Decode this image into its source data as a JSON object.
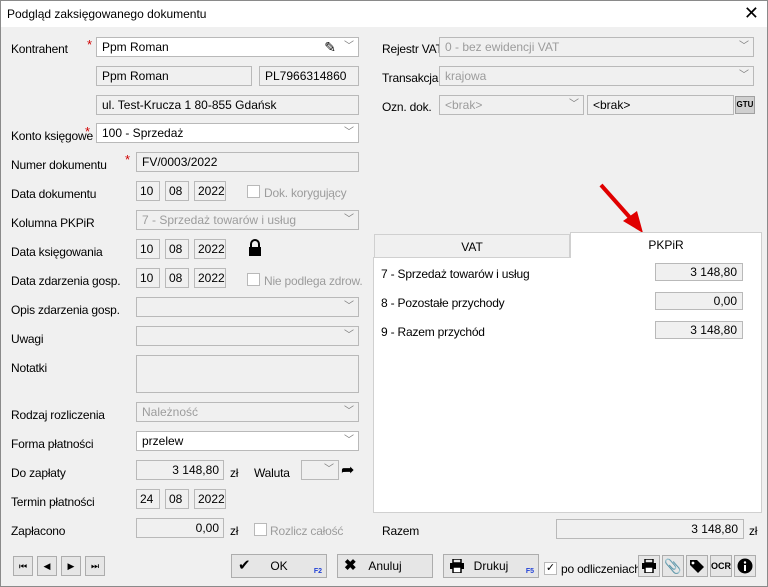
{
  "window": {
    "title": "Podgląd zaksięgowanego dokumentu"
  },
  "left": {
    "kontrahent_label": "Kontrahent",
    "kontrahent_value": "Ppm Roman",
    "kontrahent_name": "Ppm Roman",
    "kontrahent_nip": "PL7966314860",
    "kontrahent_address": "ul. Test-Krucza 1 80-855 Gdańsk",
    "konto_label": "Konto księgowe",
    "konto_value": "100 - Sprzedaż",
    "numer_label": "Numer dokumentu",
    "numer_value": "FV/0003/2022",
    "data_dok_label": "Data dokumentu",
    "data_dok": {
      "d": "10",
      "m": "08",
      "y": "2022"
    },
    "dok_kor_label": "Dok. korygujący",
    "kolumna_label": "Kolumna PKPiR",
    "kolumna_value": "7 - Sprzedaż towarów i usług",
    "data_ksieg_label": "Data księgowania",
    "data_ksieg": {
      "d": "10",
      "m": "08",
      "y": "2022"
    },
    "data_zdarz_label": "Data zdarzenia gosp.",
    "data_zdarz": {
      "d": "10",
      "m": "08",
      "y": "2022"
    },
    "nie_podlega_label": "Nie podlega zdrow.",
    "opis_label": "Opis zdarzenia gosp.",
    "uwagi_label": "Uwagi",
    "notatki_label": "Notatki",
    "rodzaj_label": "Rodzaj rozliczenia",
    "rodzaj_value": "Należność",
    "forma_label": "Forma płatności",
    "forma_value": "przelew",
    "do_zaplaty_label": "Do zapłaty",
    "do_zaplaty_value": "3 148,80",
    "currency": "zł",
    "waluta_label": "Waluta",
    "termin_label": "Termin płatności",
    "termin": {
      "d": "24",
      "m": "08",
      "y": "2022"
    },
    "zaplacono_label": "Zapłacono",
    "zaplacono_value": "0,00",
    "rozlicz_label": "Rozlicz całość"
  },
  "right": {
    "rejestr_label": "Rejestr VAT",
    "rejestr_value": "0 - bez ewidencji VAT",
    "transakcja_label": "Transakcja",
    "transakcja_value": "krajowa",
    "ozn_label": "Ozn. dok.",
    "ozn_value1": "<brak>",
    "ozn_value2": "<brak>",
    "gtu_label": "GTU",
    "tabs": [
      {
        "label": "VAT"
      },
      {
        "label": "PKPiR"
      }
    ],
    "rows": [
      {
        "label": "7 - Sprzedaż towarów i usług",
        "value": "3 148,80"
      },
      {
        "label": "8 - Pozostałe przychody",
        "value": "0,00"
      },
      {
        "label": "9 - Razem przychód",
        "value": "3 148,80"
      }
    ],
    "razem_label": "Razem",
    "razem_value": "3 148,80",
    "razem_currency": "zł"
  },
  "bottom": {
    "nav": [
      "⏮",
      "◀",
      "▶",
      "⏭"
    ],
    "ok_label": "OK",
    "ok_key": "F2",
    "anuluj_label": "Anuluj",
    "drukuj_label": "Drukuj",
    "drukuj_key": "F5",
    "po_odliczeniach_label": "po odliczeniach",
    "ocr_label": "OCR"
  },
  "colors": {
    "required": "#d00000",
    "arrow": "#e00000",
    "shortcut": "#1f3fd6"
  }
}
